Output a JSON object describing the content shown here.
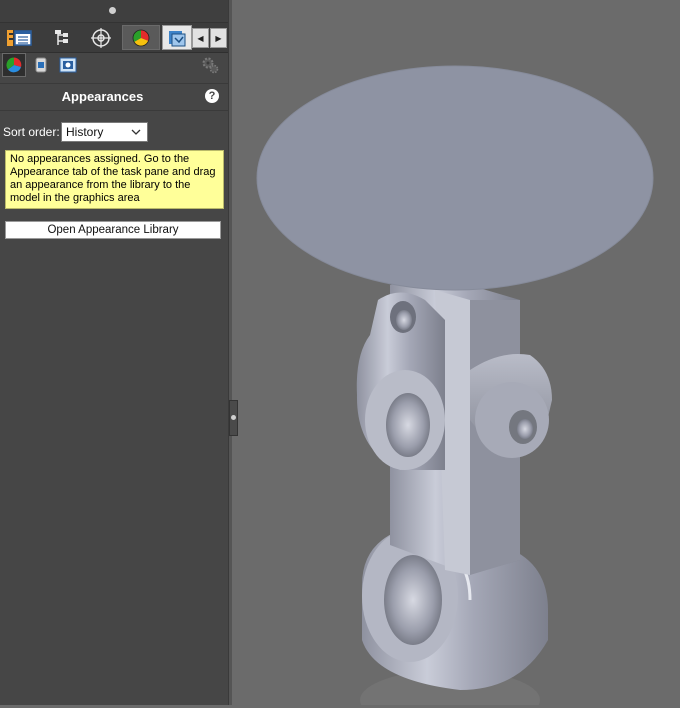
{
  "panel": {
    "title": "Appearances",
    "sort_label": "Sort order:",
    "sort_value": "History",
    "info_text": "No appearances assigned. Go to the Appearance tab of the task pane and drag an appearance from the library to the model in the graphics area",
    "open_library_label": "Open Appearance Library"
  },
  "tabs": [
    {
      "icon": "feature-manager-icon"
    },
    {
      "icon": "property-manager-icon"
    },
    {
      "icon": "configuration-manager-icon"
    },
    {
      "icon": "dimxpert-icon"
    },
    {
      "icon": "display-manager-icon"
    },
    {
      "icon": "cam-icon"
    }
  ],
  "subtabs": [
    {
      "icon": "appearances-icon"
    },
    {
      "icon": "decals-icon"
    },
    {
      "icon": "scenes-icon"
    }
  ],
  "colors": {
    "panel_bg": "#464646",
    "viewport_bg": "#6b6b6b",
    "info_bg": "#ffff99",
    "model_metal": "#a4a7b6",
    "model_top_disc": "#8e93a3"
  }
}
